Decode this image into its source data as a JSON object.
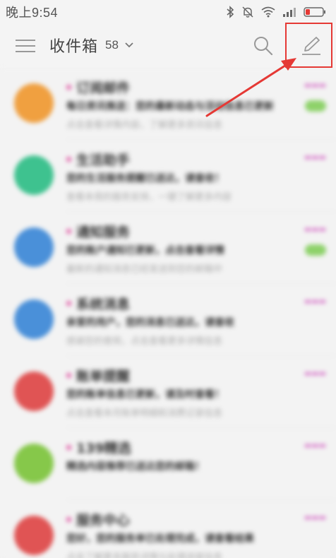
{
  "status_bar": {
    "time": "晚上9:54"
  },
  "header": {
    "title": "收件箱",
    "count": "58"
  },
  "mail_list": [
    {
      "sender": "订阅邮件",
      "subject": "每日资讯推送：您的最新动态与活动信息已更新",
      "preview": "点击查看详情内容，了解更多资讯信息",
      "avatar_color": "#f0a040",
      "has_tag": true
    },
    {
      "sender": "生活助手",
      "subject": "您的生活服务提醒已送达，请查收！",
      "preview": "查看本周的服务安排，一键了解更多内容",
      "avatar_color": "#3ec28f",
      "has_tag": false
    },
    {
      "sender": "通知服务",
      "subject": "您的账户通知已更新，点击查看详情",
      "preview": "最新的通知消息已经发送到您的邮箱中",
      "avatar_color": "#4a90d9",
      "has_tag": true
    },
    {
      "sender": "系统消息",
      "subject": "亲爱的用户，您的消息已送达，请查收",
      "preview": "感谢您的使用，点击查看更多详情信息",
      "avatar_color": "#4a90d9",
      "has_tag": false
    },
    {
      "sender": "账单提醒",
      "subject": "您的账单信息已更新，请及时查看！",
      "preview": "点击查看本月账单明细和消费记录信息",
      "avatar_color": "#e05454",
      "has_tag": false
    },
    {
      "sender": "139精选",
      "subject": "精选内容推荐已送达您的邮箱！",
      "preview": "",
      "avatar_color": "#86c84a",
      "has_tag": false
    },
    {
      "sender": "服务中心",
      "subject": "您好，您的服务单已处理完成，请查看结果",
      "preview": "点击了解更多服务详情与处理进度信息",
      "avatar_color": "#e05454",
      "has_tag": false
    }
  ]
}
